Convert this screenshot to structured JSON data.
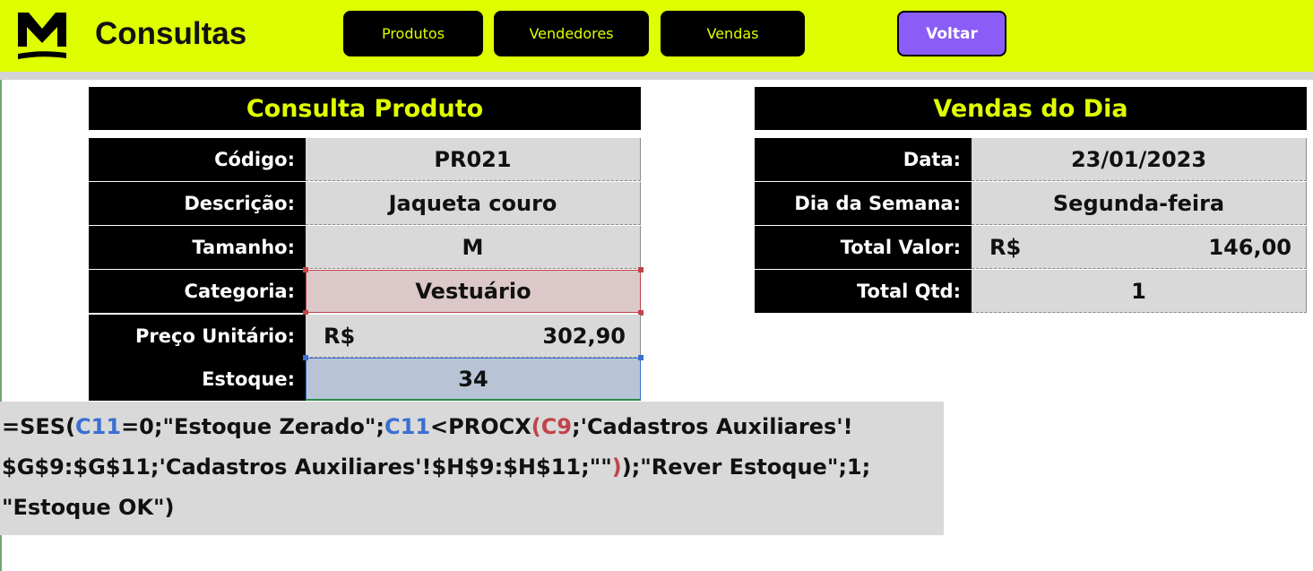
{
  "header": {
    "title": "Consultas",
    "logo_letter": "M",
    "nav": [
      "Produtos",
      "Vendedores",
      "Vendas"
    ],
    "back_label": "Voltar"
  },
  "colors": {
    "accent": "#dfff00",
    "button_bg": "#000000",
    "back_button": "#8b5cf6",
    "cell_gray": "#d9d9d9",
    "ref_blue": "#3b6fd1",
    "ref_red": "#c0444a"
  },
  "produto": {
    "title": "Consulta Produto",
    "codigo_label": "Código:",
    "codigo": "PR021",
    "descricao_label": "Descrição:",
    "descricao": "Jaqueta couro",
    "tamanho_label": "Tamanho:",
    "tamanho": "M",
    "categoria_label": "Categoria:",
    "categoria": "Vestuário",
    "preco_label": "Preço Unitário:",
    "preco_currency": "R$",
    "preco": "302,90",
    "estoque_label": "Estoque:",
    "estoque": "34"
  },
  "vendas": {
    "title": "Vendas do Dia",
    "data_label": "Data:",
    "data": "23/01/2023",
    "dia_label": "Dia da Semana:",
    "dia": "Segunda-feira",
    "total_valor_label": "Total Valor:",
    "total_valor_currency": "R$",
    "total_valor": "146,00",
    "total_qtd_label": "Total Qtd:",
    "total_qtd": "1"
  },
  "formula": {
    "p1": "=SES(",
    "ref1": "C11",
    "p2": "=0;\"Estoque Zerado\";",
    "ref2": "C11",
    "p3": "<PROCX",
    "ref3": "(C9",
    "p4": ";'Cadastros Auxiliares'!",
    "p5": "$G$9:$G$11;'Cadastros Auxiliares'!$H$9:$H$11;\"\"",
    "ref4": ")",
    "p6": ");\"Rever Estoque\";1;",
    "p7": "\"Estoque OK\")"
  }
}
